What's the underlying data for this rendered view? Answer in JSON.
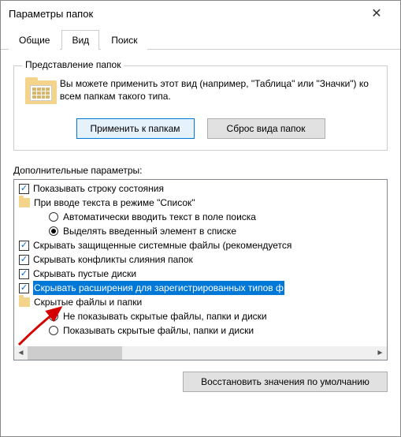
{
  "window": {
    "title": "Параметры папок"
  },
  "tabs": {
    "general": "Общие",
    "view": "Вид",
    "search": "Поиск",
    "active": "view"
  },
  "group": {
    "title": "Представление папок",
    "text": "Вы можете применить этот вид (например, \"Таблица\" или \"Значки\") ко всем папкам такого типа.",
    "apply": "Применить к папкам",
    "reset": "Сброс вида папок"
  },
  "advanced": {
    "label": "Дополнительные параметры:",
    "items": [
      {
        "type": "check",
        "checked": true,
        "indent": 0,
        "text": "Показывать строку состояния"
      },
      {
        "type": "folder",
        "indent": 0,
        "text": "При вводе текста в режиме \"Список\""
      },
      {
        "type": "radio",
        "checked": false,
        "indent": 2,
        "text": "Автоматически вводить текст в поле поиска"
      },
      {
        "type": "radio",
        "checked": true,
        "indent": 2,
        "text": "Выделять введенный элемент в списке"
      },
      {
        "type": "check",
        "checked": true,
        "indent": 0,
        "text": "Скрывать защищенные системные файлы (рекомендуется"
      },
      {
        "type": "check",
        "checked": true,
        "indent": 0,
        "text": "Скрывать конфликты слияния папок"
      },
      {
        "type": "check",
        "checked": true,
        "indent": 0,
        "text": "Скрывать пустые диски"
      },
      {
        "type": "check",
        "checked": true,
        "indent": 0,
        "highlight": true,
        "text": "Скрывать расширения для зарегистрированных типов ф"
      },
      {
        "type": "folder",
        "indent": 0,
        "text": "Скрытые файлы и папки"
      },
      {
        "type": "radio",
        "checked": true,
        "indent": 2,
        "text": "Не показывать скрытые файлы, папки и диски"
      },
      {
        "type": "radio",
        "checked": false,
        "indent": 2,
        "text": "Показывать скрытые файлы, папки и диски"
      }
    ]
  },
  "restore": "Восстановить значения по умолчанию"
}
